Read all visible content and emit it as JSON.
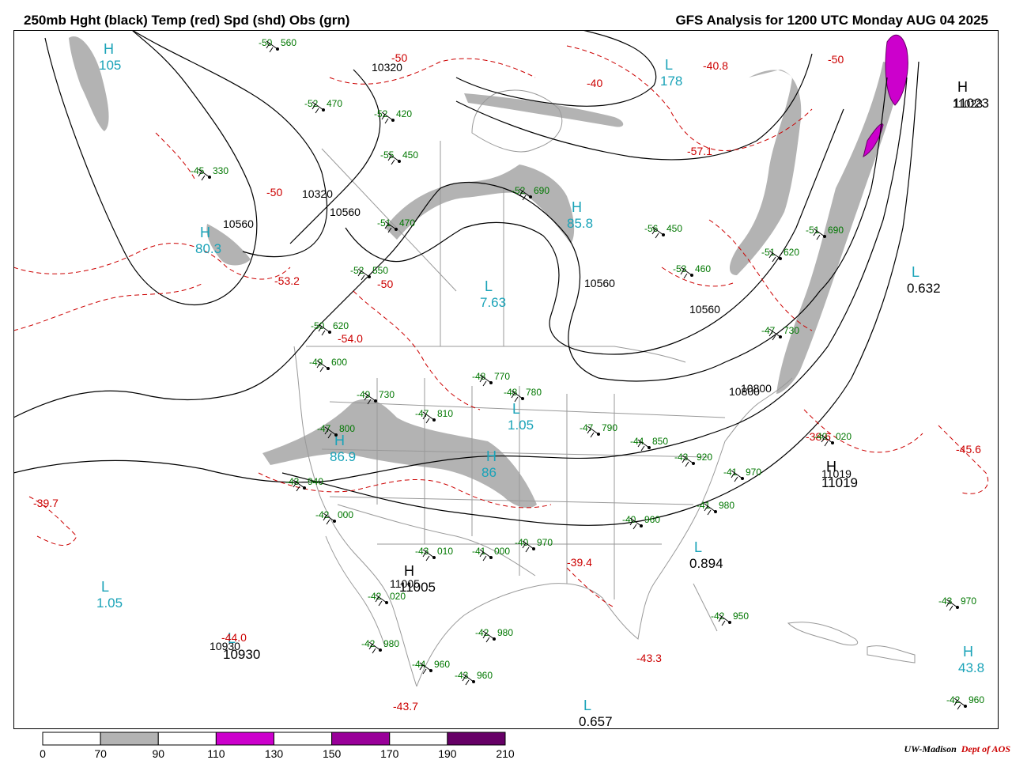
{
  "header": {
    "title_left": "250mb Hght (black) Temp (red) Spd (shd) Obs (grn)",
    "title_right": "GFS Analysis for 1200 UTC Monday  AUG 04 2025"
  },
  "colors": {
    "height_contour": "#000000",
    "temperature_contour": "#cc0000",
    "speed_70_90": "#b3b3b3",
    "speed_110_130": "#cc00cc",
    "speed_150_170": "#990099",
    "speed_190_210": "#660066",
    "observations": "#007700",
    "centers": "#1aa3b8",
    "geography": "#999999"
  },
  "height_labels": [
    "10560",
    "10320",
    "10320",
    "10560",
    "10560",
    "10800",
    "11023",
    "11019",
    "11005",
    "10930",
    "10560",
    "10800"
  ],
  "centers": [
    {
      "type": "H",
      "value": "105"
    },
    {
      "type": "L",
      "value": "178"
    },
    {
      "type": "H",
      "value": "11023"
    },
    {
      "type": "L",
      "value": "0.632"
    },
    {
      "type": "H",
      "value": "80.3"
    },
    {
      "type": "L",
      "value": "7.63"
    },
    {
      "type": "H",
      "value": "85.8"
    },
    {
      "type": "H",
      "value": "86.9"
    },
    {
      "type": "H",
      "value": "86"
    },
    {
      "type": "L",
      "value": "1.05"
    },
    {
      "type": "L",
      "value": "1.05"
    },
    {
      "type": "L",
      "value": "0.657"
    },
    {
      "type": "H",
      "value": "43.8"
    },
    {
      "type": "L",
      "value": "0.894"
    },
    {
      "type": "H",
      "value": "11005"
    },
    {
      "type": "L",
      "value": "10930"
    },
    {
      "type": "H",
      "value": "11019"
    }
  ],
  "temperature_labels": [
    "-50",
    "-40",
    "-50",
    "-53.2",
    "-54.0",
    "-38.6",
    "-45.6",
    "-39.7",
    "-44.0",
    "-43.3",
    "-43.7",
    "-39.4",
    "-57.1",
    "-40.8",
    "-50",
    "-50"
  ],
  "observations": [
    {
      "t": "-50",
      "h": "560"
    },
    {
      "t": "-52",
      "h": "470"
    },
    {
      "t": "-52",
      "h": "420"
    },
    {
      "t": "-55",
      "h": "450"
    },
    {
      "t": "-45",
      "h": "330"
    },
    {
      "t": "-51",
      "h": "470"
    },
    {
      "t": "-52",
      "h": "550"
    },
    {
      "t": "-50",
      "h": "620"
    },
    {
      "t": "-49",
      "h": "600"
    },
    {
      "t": "-49",
      "h": "730"
    },
    {
      "t": "-47",
      "h": "800"
    },
    {
      "t": "-47",
      "h": "810"
    },
    {
      "t": "-48",
      "h": "770"
    },
    {
      "t": "-48",
      "h": "780"
    },
    {
      "t": "-47",
      "h": "790"
    },
    {
      "t": "-44",
      "h": "850"
    },
    {
      "t": "-43",
      "h": "920"
    },
    {
      "t": "-41",
      "h": "970"
    },
    {
      "t": "-41",
      "h": "980"
    },
    {
      "t": "-40",
      "h": "960"
    },
    {
      "t": "-42",
      "h": "950"
    },
    {
      "t": "-43",
      "h": "970"
    },
    {
      "t": "-42",
      "h": "960"
    },
    {
      "t": "-43",
      "h": "940"
    },
    {
      "t": "-42",
      "h": "000"
    },
    {
      "t": "-42",
      "h": "020"
    },
    {
      "t": "-42",
      "h": "980"
    },
    {
      "t": "-44",
      "h": "960"
    },
    {
      "t": "-43",
      "h": "010"
    },
    {
      "t": "-41",
      "h": "000"
    },
    {
      "t": "-40",
      "h": "970"
    },
    {
      "t": "-42",
      "h": "980"
    },
    {
      "t": "-43",
      "h": "960"
    },
    {
      "t": "-40",
      "h": "020"
    },
    {
      "t": "-47",
      "h": "730"
    },
    {
      "t": "-51",
      "h": "620"
    },
    {
      "t": "-52",
      "h": "690"
    },
    {
      "t": "-53",
      "h": "460"
    },
    {
      "t": "-56",
      "h": "450"
    },
    {
      "t": "-51",
      "h": "690"
    }
  ],
  "legend": {
    "ticks": [
      "0",
      "70",
      "90",
      "110",
      "130",
      "150",
      "170",
      "190",
      "210"
    ]
  },
  "credit": {
    "org": "UW-Madison",
    "dept": "Dept of AOS"
  }
}
